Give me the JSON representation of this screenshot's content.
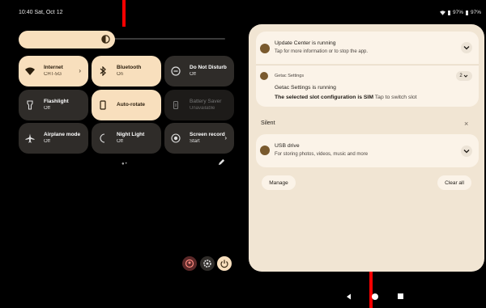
{
  "status_bar": {
    "time_date": "10:40  Sat, Oct 12",
    "battery_1": "97%",
    "battery_2": "97%"
  },
  "brightness": {
    "level_percent": 42
  },
  "tiles": [
    {
      "title": "Internet",
      "subtitle": "CHT-5G",
      "icon": "wifi-icon",
      "state": "on",
      "has_chevron": true
    },
    {
      "title": "Bluetooth",
      "subtitle": "On",
      "icon": "bluetooth-icon",
      "state": "on",
      "has_chevron": false
    },
    {
      "title": "Do Not Disturb",
      "subtitle": "Off",
      "icon": "dnd-icon",
      "state": "off",
      "has_chevron": false
    },
    {
      "title": "Flashlight",
      "subtitle": "Off",
      "icon": "flashlight-icon",
      "state": "off",
      "has_chevron": false
    },
    {
      "title": "Auto-rotate",
      "subtitle": "",
      "icon": "rotate-icon",
      "state": "on",
      "has_chevron": false
    },
    {
      "title": "Battery Saver",
      "subtitle": "Unavailable",
      "icon": "battery-icon",
      "state": "unavailable",
      "has_chevron": false
    },
    {
      "title": "Airplane mode",
      "subtitle": "Off",
      "icon": "airplane-icon",
      "state": "off",
      "has_chevron": false
    },
    {
      "title": "Night Light",
      "subtitle": "Off",
      "icon": "moon-icon",
      "state": "off",
      "has_chevron": false
    },
    {
      "title": "Screen record",
      "subtitle": "Start",
      "icon": "record-icon",
      "state": "off",
      "has_chevron": true
    }
  ],
  "notifications": {
    "update_center": {
      "title": "Update Center is running",
      "body": "Tap for more information or to stop the app."
    },
    "getac": {
      "app": "Getac Settings",
      "count": "2",
      "title": "Getac Settings is running",
      "body_bold": "The selected slot configuration is SIM",
      "body_rest": "Tap to switch slot"
    },
    "silent_label": "Silent",
    "usb": {
      "title": "USB drive",
      "body": "For storing photos, videos, music and more"
    },
    "manage_label": "Manage",
    "clear_all_label": "Clear all"
  },
  "colors": {
    "accent": "#f8dfbd",
    "tile_off": "#2f2c29",
    "panel": "#f1e5d3",
    "indicator_red": "#ff0000"
  }
}
